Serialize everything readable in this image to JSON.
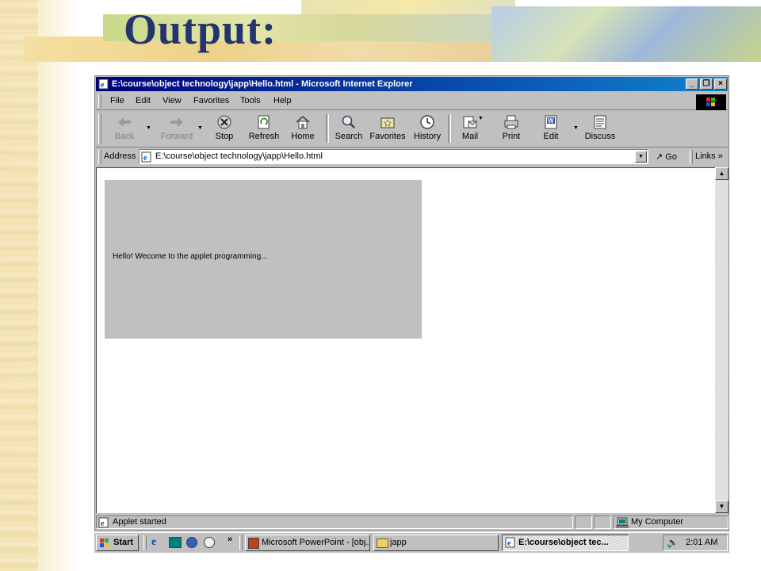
{
  "slide": {
    "title": "Output:"
  },
  "window": {
    "title": "E:\\course\\object technology\\japp\\Hello.html - Microsoft Internet Explorer",
    "controls": {
      "minimize": "_",
      "restore": "❐",
      "close": "×"
    }
  },
  "menu": [
    "File",
    "Edit",
    "View",
    "Favorites",
    "Tools",
    "Help"
  ],
  "toolbar": [
    {
      "label": "Back",
      "icon": "back-arrow-icon",
      "disabled": true
    },
    {
      "label": "Forward",
      "icon": "forward-arrow-icon",
      "disabled": true
    },
    {
      "label": "Stop",
      "icon": "stop-icon"
    },
    {
      "label": "Refresh",
      "icon": "refresh-icon"
    },
    {
      "label": "Home",
      "icon": "home-icon"
    },
    {
      "label": "Search",
      "icon": "search-icon"
    },
    {
      "label": "Favorites",
      "icon": "favorites-icon"
    },
    {
      "label": "History",
      "icon": "history-icon"
    },
    {
      "label": "Mail",
      "icon": "mail-icon"
    },
    {
      "label": "Print",
      "icon": "print-icon"
    },
    {
      "label": "Edit",
      "icon": "edit-icon"
    },
    {
      "label": "Discuss",
      "icon": "discuss-icon"
    }
  ],
  "address": {
    "label": "Address",
    "value": "E:\\course\\object technology\\japp\\Hello.html",
    "go": "Go",
    "links": "Links",
    "chevron": "»"
  },
  "applet": {
    "text": "Hello! Wecome to the applet programming..."
  },
  "status": {
    "text": "Applet started",
    "zone": "My Computer"
  },
  "taskbar": {
    "start": "Start",
    "chevron": "»",
    "buttons": [
      "Microsoft PowerPoint - [obj...",
      "japp",
      "E:\\course\\object tec..."
    ],
    "clock": "2:01 AM"
  },
  "colors": {
    "title": "#23346e",
    "titlebar_start": "#00007b",
    "titlebar_end": "#1084d0",
    "face": "#c0c0c0"
  }
}
